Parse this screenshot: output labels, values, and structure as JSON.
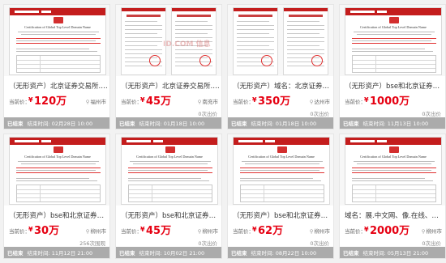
{
  "listings": [
    {
      "name": "（无形资产）北京证券交易所.网店.企业...",
      "price_label": "当前价：",
      "currency": "¥",
      "price": "120万",
      "location": "福州市",
      "bids": "",
      "status": "已结束",
      "end_time": "结束时间: 02月28日 10:00",
      "thumb": "cert"
    },
    {
      "name": "（无形资产）北京证券交易所.email.sho...",
      "price_label": "当前价：",
      "currency": "¥",
      "price": "45万",
      "location": "南充市",
      "bids": "0次出价",
      "status": "已结束",
      "end_time": "结束时间: 01月18日 10:00",
      "thumb": "cert2"
    },
    {
      "name": "（无形资产）域名：北京证券交易所.tech",
      "price_label": "当前价：",
      "currency": "¥",
      "price": "350万",
      "location": "达州市",
      "bids": "0次出价",
      "status": "已结束",
      "end_time": "结束时间: 01月18日 10:00",
      "thumb": "cert2b"
    },
    {
      "name": "（无形资产）bse和北京证券交易所资...",
      "price_label": "当前价：",
      "currency": "¥",
      "price": "1000万",
      "location": "",
      "bids": "0次出价",
      "status": "已结束",
      "end_time": "结束时间: 11月13日 10:00",
      "thumb": "cert"
    },
    {
      "name": "（无形资产）bse和北京证券交易所资源...",
      "price_label": "当前价：",
      "currency": "¥",
      "price": "30万",
      "location": "柳州市",
      "bids": "256次围观",
      "status": "已结束",
      "end_time": "结束时间: 11月12日 21:00",
      "thumb": "cert"
    },
    {
      "name": "（无形资产）bse和北京证券交易所资源...",
      "price_label": "当前价：",
      "currency": "¥",
      "price": "45万",
      "location": "柳州市",
      "bids": "0次出价",
      "status": "已结束",
      "end_time": "结束时间: 10月02日 21:00",
      "thumb": "cert"
    },
    {
      "name": "（无形资产）bse和北京证券交易所资源...",
      "price_label": "当前价：",
      "currency": "¥",
      "price": "62万",
      "location": "柳州市",
      "bids": "0次出价",
      "status": "已结束",
      "end_time": "结束时间: 08月22日 10:00",
      "thumb": "cert"
    },
    {
      "name": "域名：展.中文网、像.在线、腾讯风.手...",
      "price_label": "当前价：",
      "currency": "¥",
      "price": "2000万",
      "location": "柳州市",
      "bids": "0次出价",
      "status": "已结束",
      "end_time": "结束时间: 05月13日 21:00",
      "thumb": "cert"
    }
  ],
  "cert_title": "Certification of Global Top Level Domain Name",
  "watermark": "ID.COM 信息",
  "colors": {
    "price": "#e60012",
    "status_bar": "#ababab",
    "stamp": "#e03030"
  }
}
